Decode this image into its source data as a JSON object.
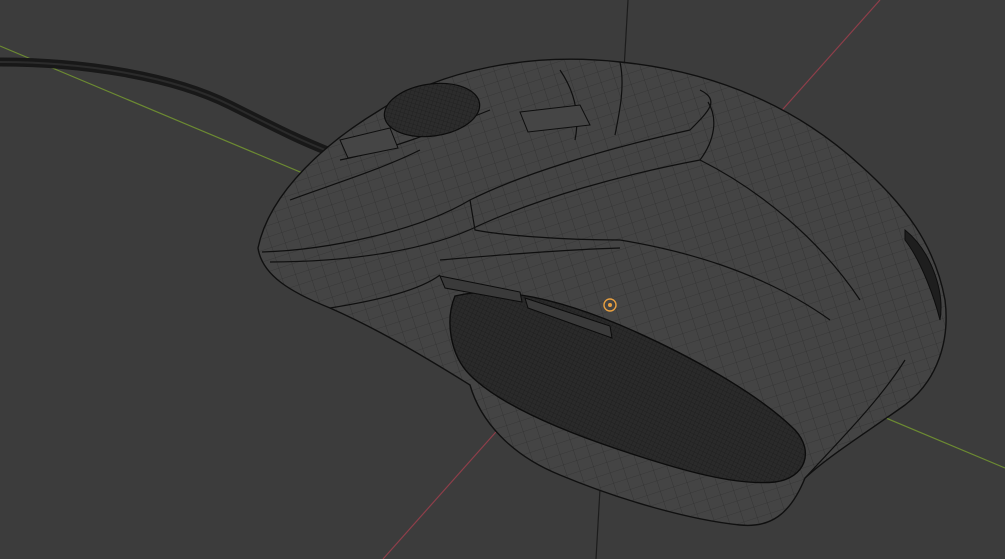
{
  "viewport": {
    "background": "#3c3c3c",
    "shading": "wireframe",
    "wire_color": "#101010",
    "mesh_fill": "#444444",
    "cavity_fill": "#2a2a2a"
  },
  "axes": {
    "x_color": "#8e3e4a",
    "y_color": "#6c8a32",
    "z_color": "#1c1c1c"
  },
  "object": {
    "icon": "computer-mouse-mesh",
    "cable_color": "#181818"
  },
  "origin": {
    "icon": "object-origin-icon",
    "color": "#e8a040"
  }
}
